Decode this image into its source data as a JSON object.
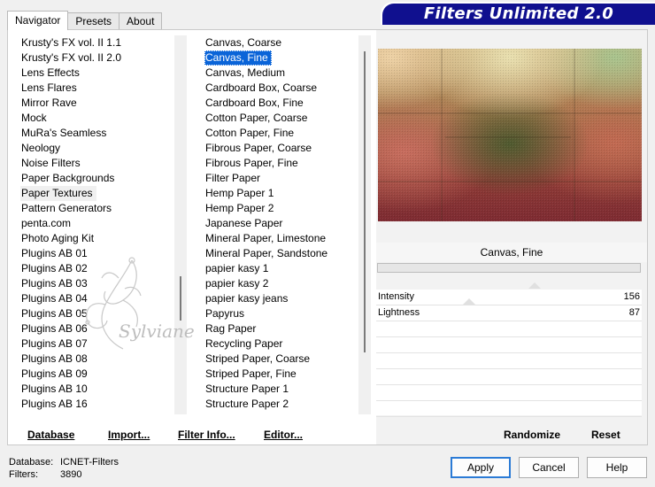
{
  "tabs": [
    {
      "label": "Navigator",
      "active": true
    },
    {
      "label": "Presets",
      "active": false
    },
    {
      "label": "About",
      "active": false
    }
  ],
  "banner": {
    "title": "Filters Unlimited 2.0",
    "color": "#10108f"
  },
  "categories": {
    "items": [
      "Krusty's FX vol. II 1.1",
      "Krusty's FX vol. II 2.0",
      "Lens Effects",
      "Lens Flares",
      "Mirror Rave",
      "Mock",
      "MuRa's Seamless",
      "Neology",
      "Noise Filters",
      "Paper Backgrounds",
      "Paper Textures",
      "Pattern Generators",
      "penta.com",
      "Photo Aging Kit",
      "Plugins AB 01",
      "Plugins AB 02",
      "Plugins AB 03",
      "Plugins AB 04",
      "Plugins AB 05",
      "Plugins AB 06",
      "Plugins AB 07",
      "Plugins AB 08",
      "Plugins AB 09",
      "Plugins AB 10",
      "Plugins AB 16"
    ],
    "selected_index": 10
  },
  "filters": {
    "items": [
      "Canvas, Coarse",
      "Canvas, Fine",
      "Canvas, Medium",
      "Cardboard Box, Coarse",
      "Cardboard Box, Fine",
      "Cotton Paper, Coarse",
      "Cotton Paper, Fine",
      "Fibrous Paper, Coarse",
      "Fibrous Paper, Fine",
      "Filter Paper",
      "Hemp Paper 1",
      "Hemp Paper 2",
      "Japanese Paper",
      "Mineral Paper, Limestone",
      "Mineral Paper, Sandstone",
      "papier kasy 1",
      "papier kasy 2",
      "papier kasy jeans",
      "Papyrus",
      "Rag Paper",
      "Recycling Paper",
      "Striped Paper, Coarse",
      "Striped Paper, Fine",
      "Structure Paper 1",
      "Structure Paper 2"
    ],
    "selected_index": 1,
    "selection_color": "#0a64d8"
  },
  "watermark": {
    "text": "Sylviane"
  },
  "preview": {
    "filter_name": "Canvas, Fine"
  },
  "params": [
    {
      "name": "Intensity",
      "value": "156"
    },
    {
      "name": "Lightness",
      "value": "87"
    }
  ],
  "bottom_buttons": {
    "database": "Database",
    "import": "Import...",
    "filter_info": "Filter Info...",
    "editor": "Editor...",
    "randomize": "Randomize",
    "reset": "Reset"
  },
  "status": {
    "database_label": "Database:",
    "database_value": "ICNET-Filters",
    "filters_label": "Filters:",
    "filters_value": "3890"
  },
  "dialog_buttons": {
    "apply": "Apply",
    "cancel": "Cancel",
    "help": "Help"
  }
}
